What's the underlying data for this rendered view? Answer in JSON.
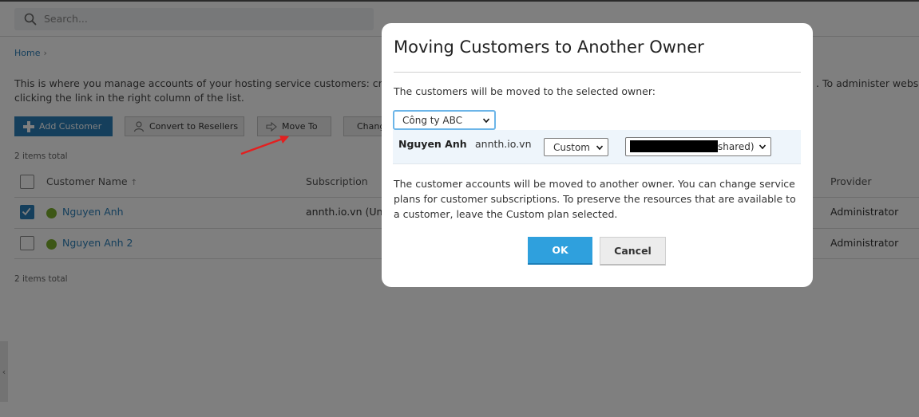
{
  "search": {
    "placeholder": "Search..."
  },
  "breadcrumb": {
    "home": "Home",
    "sep": "›"
  },
  "intro": {
    "line1": "This is where you manage accounts of your hosting service customers: create a",
    "line1_right": ". To administer website",
    "line2": "clicking the link in the right column of the list."
  },
  "toolbar": {
    "add_customer": "Add Customer",
    "convert_resellers": "Convert to Resellers",
    "move_to": "Move To",
    "change": "Chang"
  },
  "items_total_top": "2 items total",
  "items_total_bottom": "2 items total",
  "table": {
    "headers": {
      "customer_name": "Customer Name",
      "sort_indicator": "↑",
      "subscription": "Subscription",
      "provider": "Provider"
    },
    "rows": [
      {
        "name": "Nguyen Anh",
        "subscription": "annth.io.vn (Unli",
        "provider": "Administrator",
        "checked": true
      },
      {
        "name": "Nguyen Anh 2",
        "subscription": "",
        "provider": "Administrator",
        "checked": false
      }
    ]
  },
  "left_tab": "‹",
  "dialog": {
    "title": "Moving Customers to Another Owner",
    "subtitle": "The customers will be moved to the selected owner:",
    "owner_selected": "Công ty ABC",
    "customer": {
      "name": "Nguyen Anh",
      "domain": "annth.io.vn",
      "plan_selected": "Custom",
      "subscription_selected_suffix": "shared)"
    },
    "note": "The customer accounts will be moved to another owner. You can change service plans for customer subscriptions. To preserve the resources that are available to a customer, leave the Custom plan selected.",
    "ok_label": "OK",
    "cancel_label": "Cancel"
  },
  "colors": {
    "accent": "#2b7fb8",
    "ok_button": "#2fa0dd",
    "status_ok": "#7aae2c",
    "annotation_arrow": "#e32020"
  }
}
